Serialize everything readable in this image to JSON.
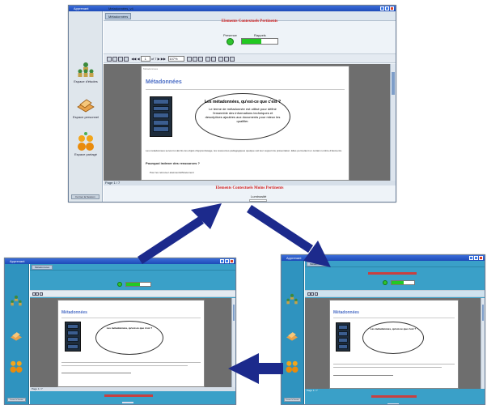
{
  "top": {
    "window_title": "Apprenant",
    "sidebar": [
      {
        "label": "Espace d'études"
      },
      {
        "label": "Espace personnel"
      },
      {
        "label": "Espace partagé"
      }
    ],
    "sidebar_bottom": "Fermer la Session",
    "tabs": {
      "main_tab": "Métadonnées",
      "doc_tab": "Metadonnées_v4"
    },
    "header_red": "Elements Contextuels Pertinents",
    "presence_label": "Presence",
    "progress_label": "Rappels",
    "progress_value": 0.55,
    "toolbar": {
      "page_input": "1",
      "page_count": "of 7",
      "zoom": "107%"
    },
    "doc": {
      "breadcrumb": "Métadonnées",
      "title": "Métadonnées",
      "bubble_title": "Les métadonnées, qu'est-ce que c'est ?",
      "bubble_text": "Le terme de métadonnée est utilisé pour définir l'ensemble des informations techniques et descriptives ajoutées aux documents pour mieux les qualifier.",
      "paragraph": "Les métadonnées servent à décrire les objets d'apprentissage, les ressources pédagogiques quelque soit leur support de présentation. Elles permettent un certain nombre d'éléments.",
      "question": "Pourquoi indexer des ressources ?",
      "bullet": "Pour les retrouver aisément/efficacement"
    },
    "footer_page": "Page 1 / 7",
    "footer_red": "Elements Contextuels Moins Pertinents",
    "footer_sub": "Luminosité"
  },
  "left": {
    "window_title": "Apprenant",
    "tab": "Métadonnées",
    "doc_title": "Métadonnées",
    "bubble_title": "Les métadonnées, qu'est-ce que c'est ?",
    "footer_page": "Page 1 / 7",
    "sidebar_bottom": "Fermer la Session"
  },
  "right": {
    "window_title": "Apprenant",
    "tab": "Métadonnées",
    "doc_title": "Métadonnées",
    "bubble_title": "Les métadonnées, qu'est-ce que c'est ?",
    "footer_page": "Page 1 / 7",
    "sidebar_bottom": "Fermer la Session"
  },
  "colors": {
    "arrow": "#1c2a8c",
    "teal": "#3aa0c8",
    "red_text": "#d21f1f",
    "title_blue": "#4d6fc6"
  }
}
